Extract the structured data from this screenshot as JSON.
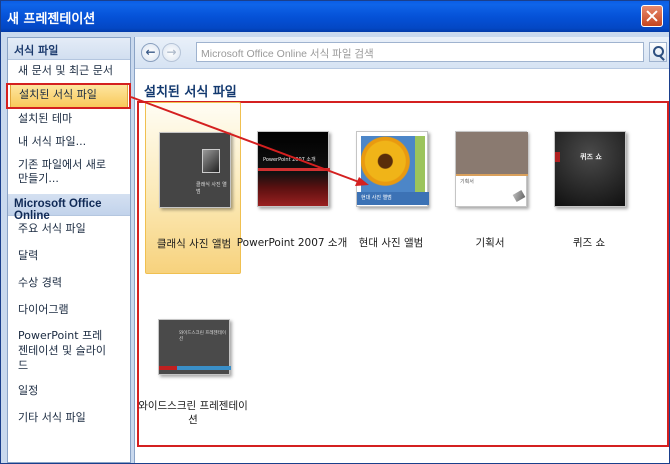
{
  "window": {
    "title": "새 프레젠테이션"
  },
  "sidebar": {
    "section1_header": "서식 파일",
    "items1": [
      {
        "label": "새 문서 및 최근 문서"
      },
      {
        "label": "설치된 서식 파일"
      },
      {
        "label": "설치된 테마"
      },
      {
        "label": "내 서식 파일..."
      },
      {
        "label": "기존 파일에서 새로 만들기..."
      }
    ],
    "section2_header": "Microsoft Office Online",
    "items2": [
      {
        "label": "주요 서식 파일"
      },
      {
        "label": "달력"
      },
      {
        "label": "수상 경력"
      },
      {
        "label": "다이어그램"
      },
      {
        "label": "PowerPoint 프레젠테이션 및 슬라이드"
      },
      {
        "label": "일정"
      },
      {
        "label": "기타 서식 파일"
      }
    ]
  },
  "toolbar": {
    "back_icon": "back-arrow-icon",
    "forward_icon": "forward-arrow-icon",
    "search_placeholder": "Microsoft Office Online 서식 파일 검색",
    "search_icon": "search-icon"
  },
  "main": {
    "section_title": "설치된 서식 파일",
    "templates": [
      {
        "label": "클래식 사진 앨범",
        "thumb_text": "클래식 사진 앨범"
      },
      {
        "label": "PowerPoint 2007 소개",
        "thumb_text": "PowerPoint 2007 소개"
      },
      {
        "label": "현대 사진 앨범",
        "thumb_text": "현대 사진 앨범"
      },
      {
        "label": "기획서",
        "thumb_text": "기획서"
      },
      {
        "label": "퀴즈 쇼",
        "thumb_text": "퀴즈 쇼"
      },
      {
        "label": "와이드스크린 프레젠테이션",
        "thumb_text": "와이드스크린 프레젠테이션"
      }
    ]
  },
  "colors": {
    "highlight_border": "#d42020",
    "selection": "#f9c95a",
    "titlebar": "#0552d8"
  }
}
